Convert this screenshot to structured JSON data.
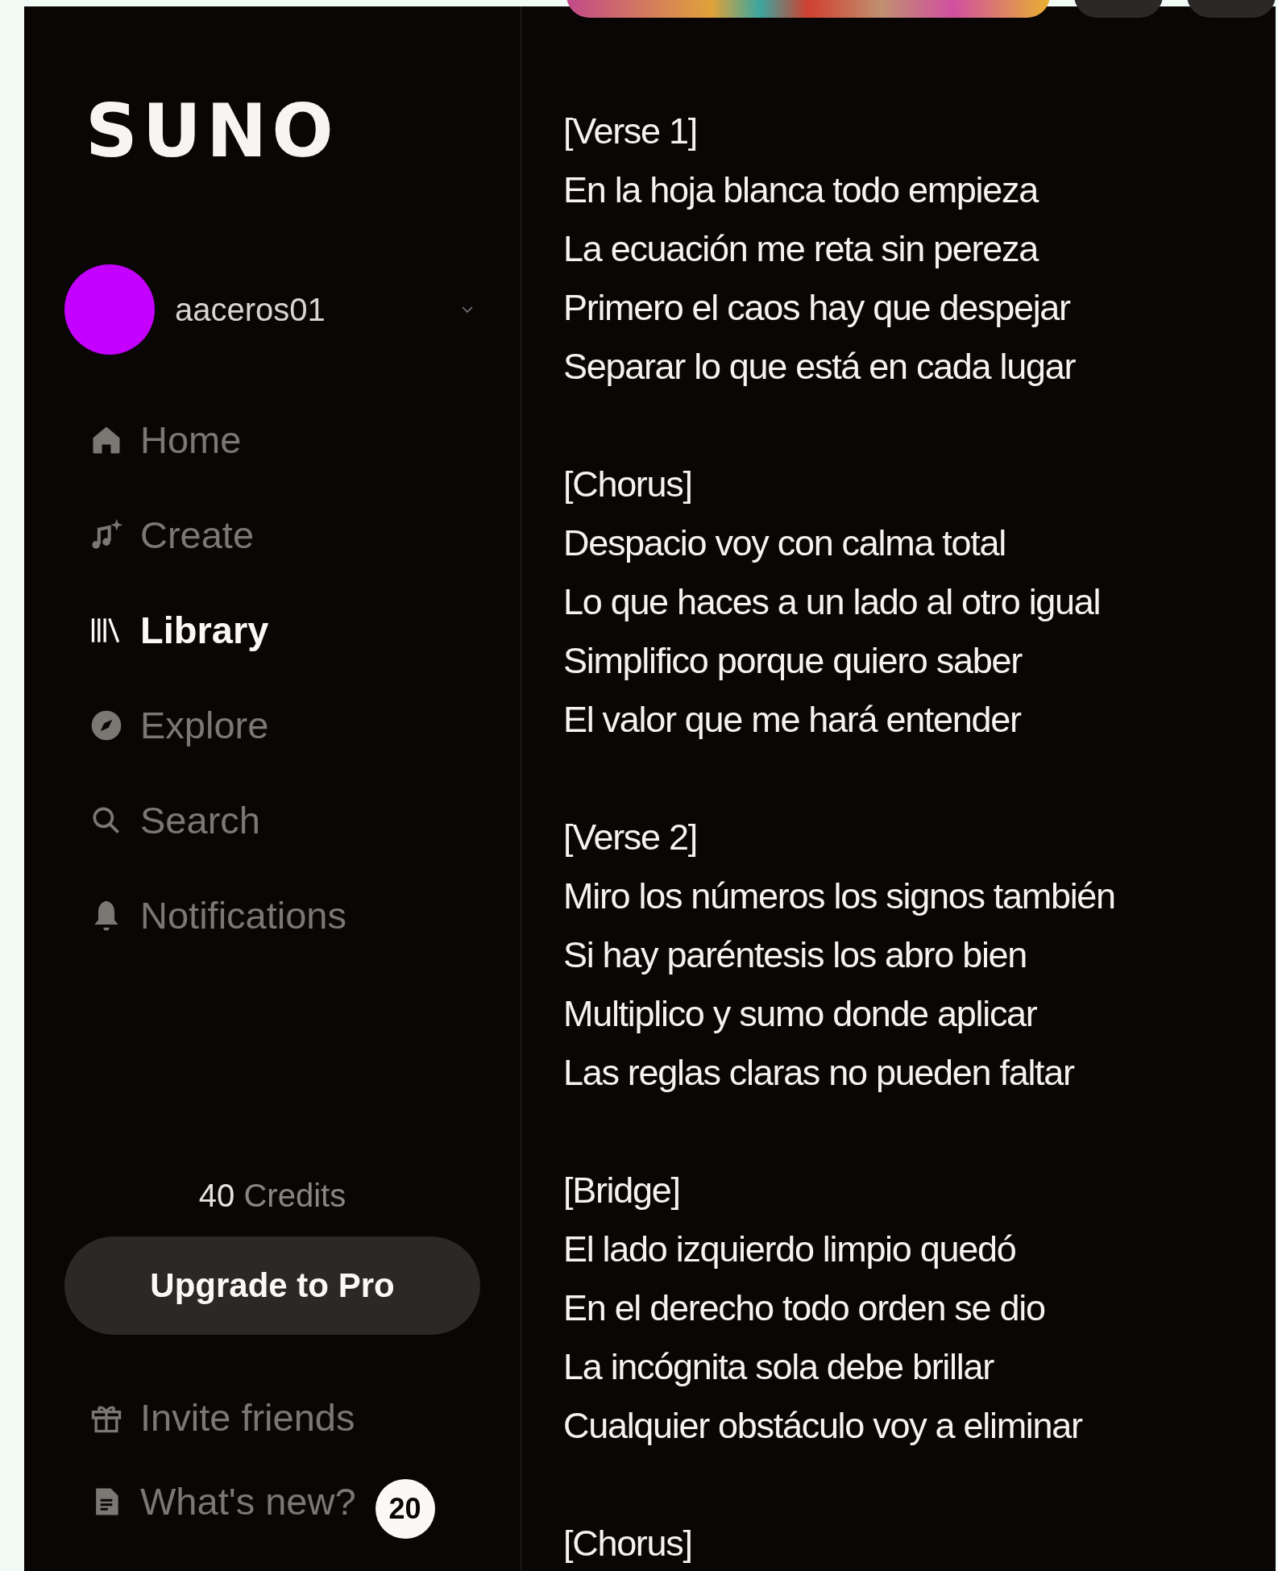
{
  "sidebar": {
    "logo": "SUNO",
    "user": {
      "name": "aaceros01",
      "color": "#c400ff"
    },
    "nav": [
      {
        "kind": "home",
        "label": "Home",
        "selected": false
      },
      {
        "kind": "create",
        "label": "Create",
        "selected": false
      },
      {
        "kind": "library",
        "label": "Library",
        "selected": true
      },
      {
        "kind": "explore",
        "label": "Explore",
        "selected": false
      },
      {
        "kind": "search",
        "label": "Search",
        "selected": false
      },
      {
        "kind": "notifications",
        "label": "Notifications",
        "selected": false
      }
    ],
    "credits": {
      "amount": "40",
      "label": "Credits"
    },
    "upgrade_button": "Upgrade to Pro",
    "footer": [
      {
        "kind": "invite",
        "label": "Invite friends"
      },
      {
        "kind": "news",
        "label": "What's new?",
        "badge": "20"
      }
    ]
  },
  "lyrics": [
    {
      "heading": "[Verse 1]",
      "lines": [
        "En la hoja blanca todo empieza",
        "La ecuación me reta sin pereza",
        "Primero el caos hay que despejar",
        "Separar lo que está en cada lugar"
      ]
    },
    {
      "heading": "[Chorus]",
      "lines": [
        "Despacio voy con calma total",
        "Lo que haces a un lado al otro igual",
        "Simplifico porque quiero saber",
        "El valor que me hará entender"
      ]
    },
    {
      "heading": "[Verse 2]",
      "lines": [
        "Miro los números los signos también",
        "Si hay paréntesis los abro bien",
        "Multiplico y sumo donde aplicar",
        "Las reglas claras no pueden faltar"
      ]
    },
    {
      "heading": "[Bridge]",
      "lines": [
        "El lado izquierdo limpio quedó",
        "En el derecho todo orden se dio",
        "La incógnita sola debe brillar",
        "Cualquier obstáculo voy a eliminar"
      ]
    },
    {
      "heading": "[Chorus]"
    }
  ]
}
